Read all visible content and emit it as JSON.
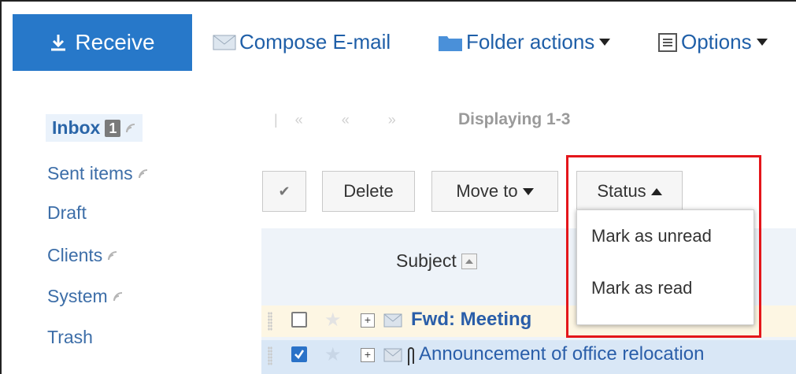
{
  "toolbar": {
    "receive_label": "Receive",
    "compose_label": "Compose E-mail",
    "folder_actions_label": "Folder actions",
    "options_label": "Options"
  },
  "sidebar": {
    "folders": [
      {
        "label": "Inbox",
        "badge": "1",
        "rss": true
      },
      {
        "label": "Sent items",
        "rss": true
      },
      {
        "label": "Draft",
        "rss": false
      },
      {
        "label": "Clients",
        "rss": true
      },
      {
        "label": "System",
        "rss": true
      },
      {
        "label": "Trash",
        "rss": false
      }
    ]
  },
  "pager": {
    "arrows": "|« « »",
    "text": "Displaying 1-3"
  },
  "actions": {
    "select_all_glyph": "✔",
    "delete_label": "Delete",
    "move_to_label": "Move to",
    "status_label": "Status"
  },
  "status_menu": {
    "items": [
      "Mark as unread",
      "Mark as read"
    ]
  },
  "table": {
    "subject_header": "Subject",
    "rows": [
      {
        "subject": "Fwd: Meeting",
        "checked": false,
        "attachment": false,
        "bold": true
      },
      {
        "subject": "Announcement of office relocation",
        "checked": true,
        "attachment": true,
        "bold": false
      }
    ]
  },
  "colors": {
    "accent": "#2778c9",
    "link": "#2a5ea9",
    "highlight": "#e4161b"
  }
}
